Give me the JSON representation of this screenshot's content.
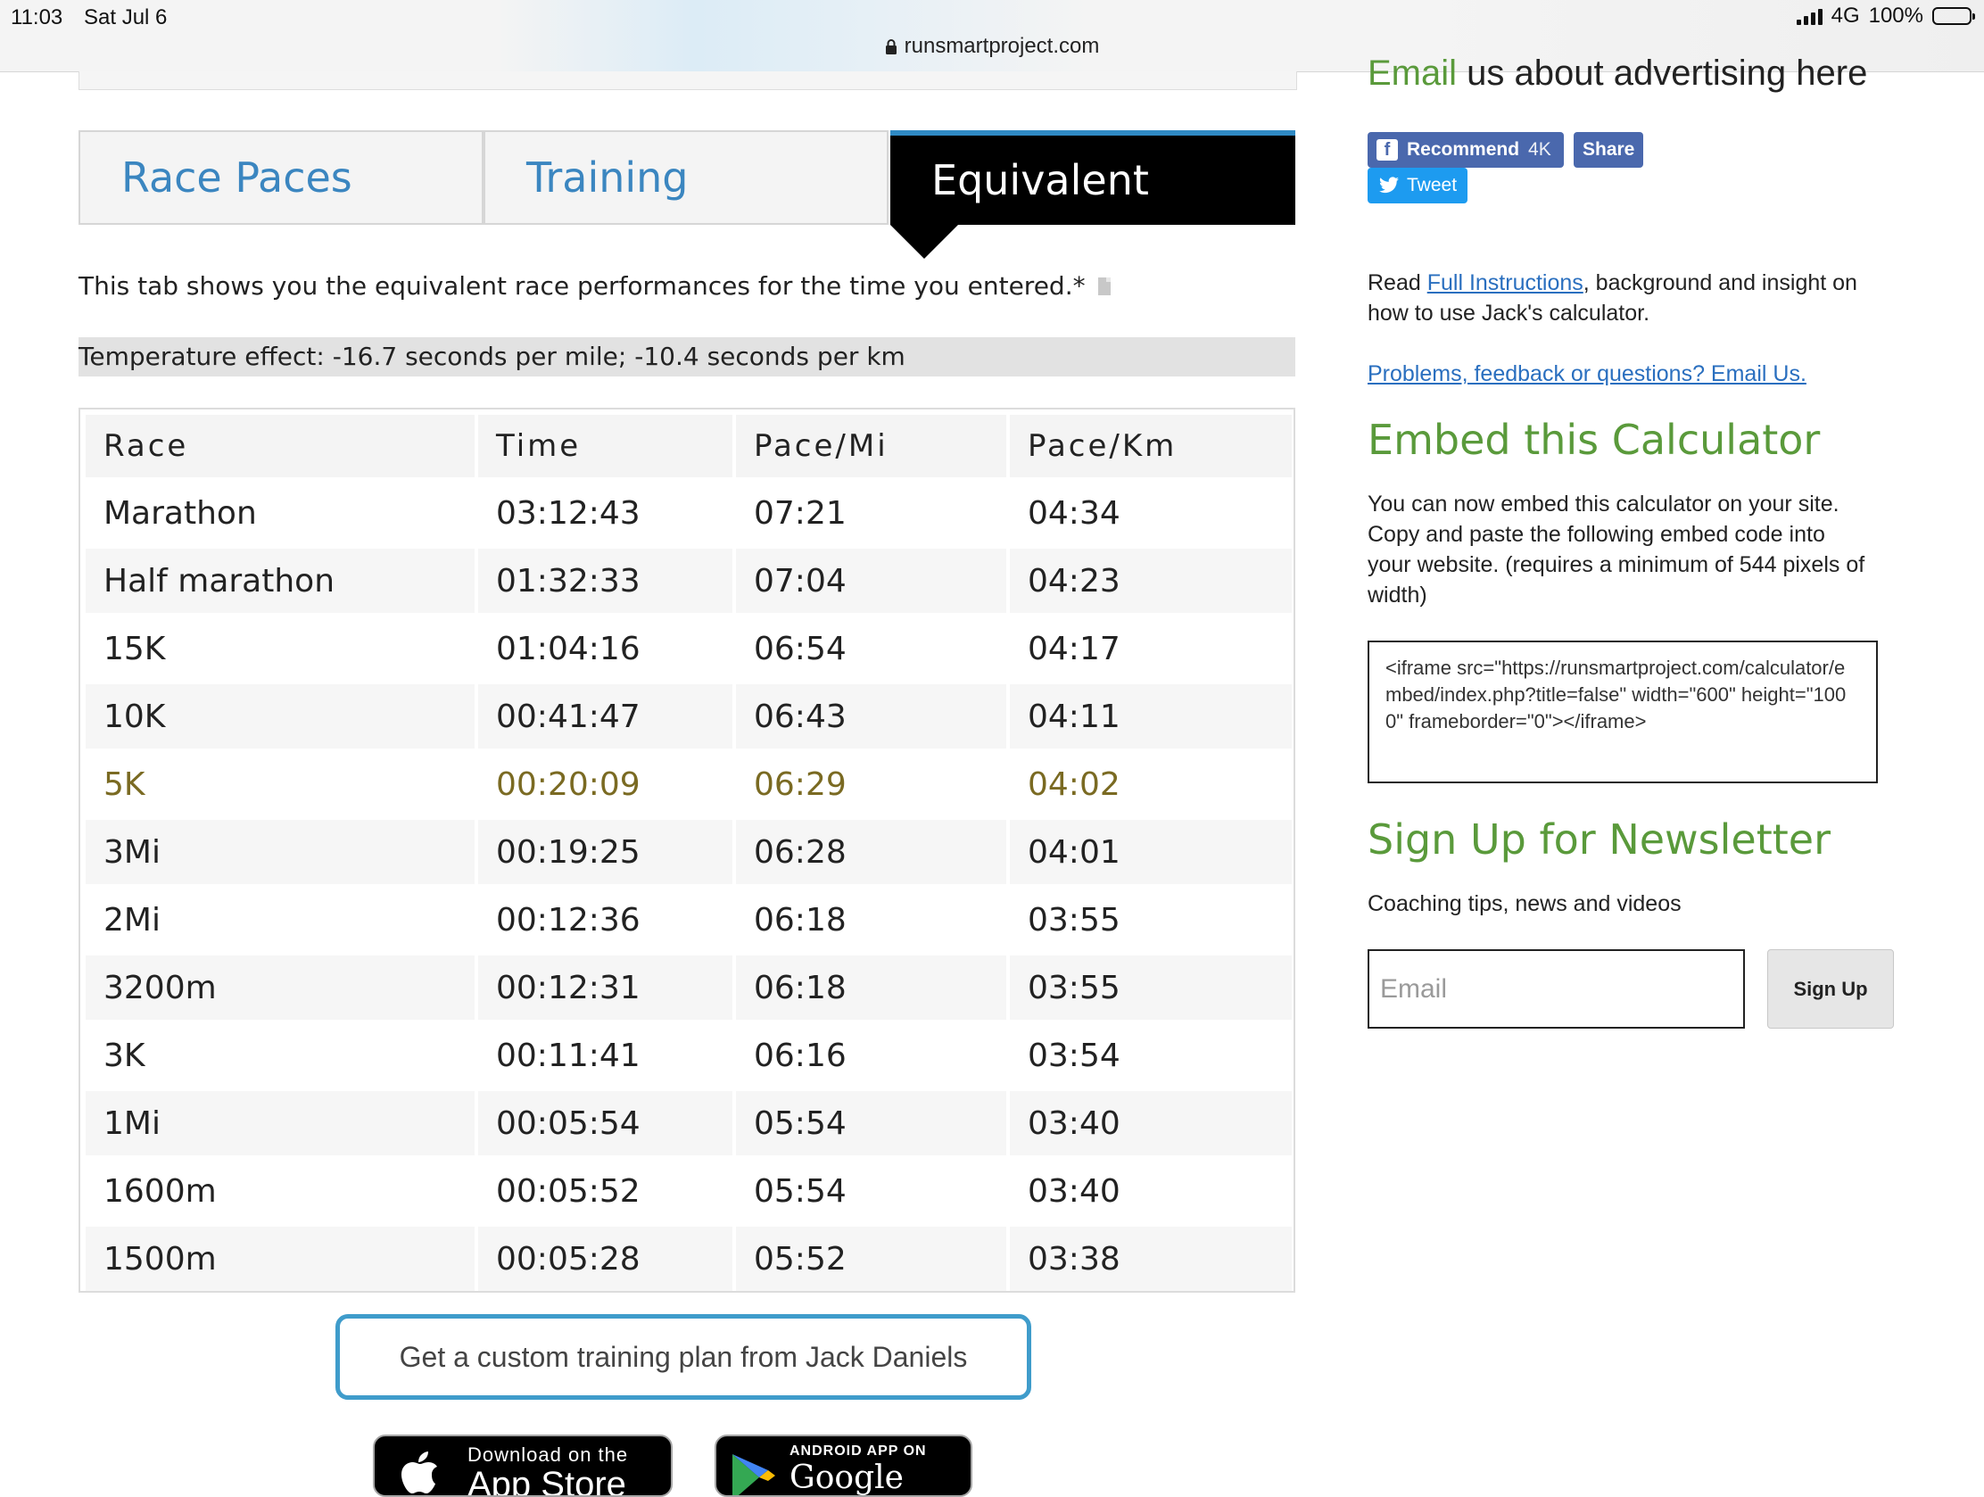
{
  "status_bar": {
    "time": "11:03",
    "date": "Sat Jul 6",
    "network": "4G",
    "battery": "100%"
  },
  "url_bar": {
    "domain": "runsmartproject.com"
  },
  "tabs": [
    {
      "label": "Race Paces",
      "active": false
    },
    {
      "label": "Training",
      "active": false
    },
    {
      "label": "Equivalent",
      "active": true
    }
  ],
  "description": "This tab shows you the equivalent race performances for the time you entered.*",
  "temperature_effect": "Temperature effect: -16.7 seconds per mile; -10.4 seconds per km",
  "table": {
    "headers": [
      "Race",
      "Time",
      "Pace/Mi",
      "Pace/Km"
    ],
    "rows": [
      [
        "Marathon",
        "03:12:43",
        "07:21",
        "04:34"
      ],
      [
        "Half marathon",
        "01:32:33",
        "07:04",
        "04:23"
      ],
      [
        "15K",
        "01:04:16",
        "06:54",
        "04:17"
      ],
      [
        "10K",
        "00:41:47",
        "06:43",
        "04:11"
      ],
      [
        "5K",
        "00:20:09",
        "06:29",
        "04:02"
      ],
      [
        "3Mi",
        "00:19:25",
        "06:28",
        "04:01"
      ],
      [
        "2Mi",
        "00:12:36",
        "06:18",
        "03:55"
      ],
      [
        "3200m",
        "00:12:31",
        "06:18",
        "03:55"
      ],
      [
        "3K",
        "00:11:41",
        "06:16",
        "03:54"
      ],
      [
        "1Mi",
        "00:05:54",
        "05:54",
        "03:40"
      ],
      [
        "1600m",
        "00:05:52",
        "05:54",
        "03:40"
      ],
      [
        "1500m",
        "00:05:28",
        "05:52",
        "03:38"
      ]
    ],
    "highlighted_row": "5K",
    "highlight_color": "#fbeeb0"
  },
  "plan_button": "Get a custom training plan from Jack Daniels",
  "app_store": {
    "small": "Download on the",
    "big": "App Store"
  },
  "google_play": {
    "small": "ANDROID APP ON",
    "big": "Google play"
  },
  "sidebar": {
    "ad_link": "Email",
    "ad_text": " us about advertising here",
    "facebook": {
      "recommend": "Recommend",
      "count": "4K",
      "share": "Share"
    },
    "tweet": "Tweet",
    "instructions": {
      "prefix": "Read ",
      "link": "Full Instructions",
      "suffix": ", background and insight on how to use Jack's calculator."
    },
    "feedback_link": "Problems, feedback or questions? Email Us.",
    "embed_heading": "Embed this Calculator",
    "embed_text": "You can now embed this calculator on your site. Copy and paste the following embed code into your website. (requires a minimum of 544 pixels of width)",
    "embed_code": "<iframe src=\"https://runsmartproject.com/calculator/embed/index.php?title=false\" width=\"600\" height=\"1000\" frameborder=\"0\"></iframe>",
    "newsletter_heading": "Sign Up for Newsletter",
    "newsletter_text": "Coaching tips, news and videos",
    "email_placeholder": "Email",
    "signup_label": "Sign Up"
  },
  "colors": {
    "accent_blue": "#3b86c0",
    "heading_green": "#5a9a3b",
    "facebook": "#4a68ad",
    "twitter": "#1d9bf0"
  }
}
